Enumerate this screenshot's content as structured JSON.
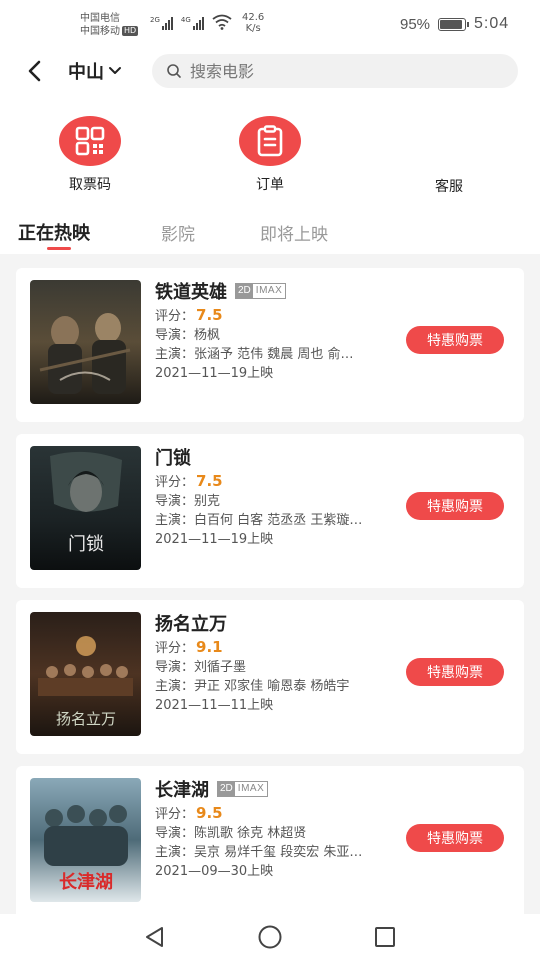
{
  "status_bar": {
    "carrier1": "中国电信",
    "carrier2": "中国移动",
    "hd_badge": "HD",
    "net1": "2G",
    "net2": "4G",
    "speed_value": "42.6",
    "speed_unit": "K/s",
    "battery_pct": "95%",
    "battery_level": 0.95,
    "time": "5:04"
  },
  "header": {
    "city": "中山",
    "search_placeholder": "搜索电影"
  },
  "quick_actions": [
    {
      "label": "取票码",
      "icon": "qrcode-icon"
    },
    {
      "label": "订单",
      "icon": "order-list-icon"
    },
    {
      "label": "客服",
      "icon": ""
    }
  ],
  "tabs": [
    {
      "label": "正在热映",
      "active": true
    },
    {
      "label": "影院",
      "active": false
    },
    {
      "label": "即将上映",
      "active": false
    }
  ],
  "movies": [
    {
      "title": "铁道英雄",
      "format_2d": "2D",
      "format_imax": "IMAX",
      "score_label": "评分：",
      "score": "7.5",
      "director": "导演：杨枫",
      "cast": "主演：张涵予  范伟  魏晨  周也  俞…",
      "date": "2021—11—19上映",
      "button": "特惠购票"
    },
    {
      "title": "门锁",
      "score_label": "评分：",
      "score": "7.5",
      "director": "导演：别克",
      "cast": "主演：白百何  白客  范丞丞  王紫璇…",
      "date": "2021—11—19上映",
      "button": "特惠购票",
      "poster_title": "门锁"
    },
    {
      "title": "扬名立万",
      "score_label": "评分：",
      "score": "9.1",
      "director": "导演：刘循子墨",
      "cast": "主演：尹正  邓家佳  喻恩泰  杨皓宇",
      "date": "2021—11—11上映",
      "button": "特惠购票",
      "poster_title": "扬名立万"
    },
    {
      "title": "长津湖",
      "format_2d": "2D",
      "format_imax": "IMAX",
      "score_label": "评分：",
      "score": "9.5",
      "director": "导演：陈凯歌  徐克  林超贤",
      "cast": "主演：吴京  易烊千玺  段奕宏  朱亚…",
      "date": "2021—09—30上映",
      "button": "特惠购票",
      "poster_title": "长津湖"
    }
  ],
  "colors": {
    "accent": "#ef4a4a",
    "score": "#e8891a"
  }
}
